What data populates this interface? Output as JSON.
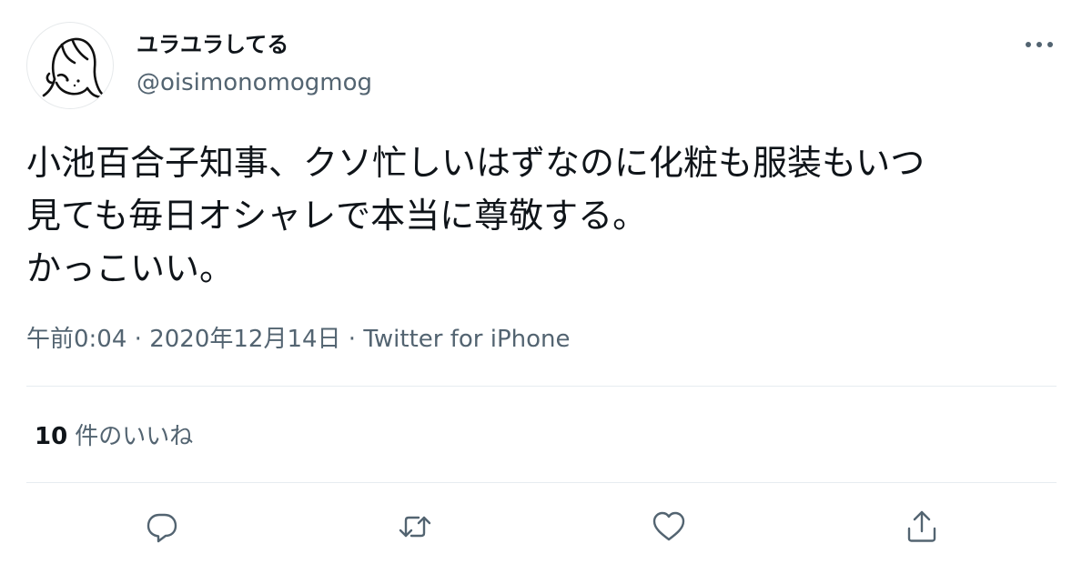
{
  "author": {
    "display_name": "ユラユラしてる",
    "handle": "@oisimonomogmog",
    "avatar_icon": "user-avatar-drawing"
  },
  "tweet": {
    "text": "小池百合子知事、クソ忙しいはずなのに化粧も服装もいつ\n見ても毎日オシャレで本当に尊敬する。\nかっこいい。",
    "time": "午前0:04",
    "separator": "·",
    "date": "2020年12月14日",
    "source": "Twitter for iPhone"
  },
  "stats": {
    "likes_count": "10",
    "likes_label": "件のいいね"
  },
  "actions": [
    {
      "name": "reply",
      "icon": "reply-icon"
    },
    {
      "name": "retweet",
      "icon": "retweet-icon"
    },
    {
      "name": "like",
      "icon": "heart-icon"
    },
    {
      "name": "share",
      "icon": "share-icon"
    }
  ],
  "colors": {
    "text_primary": "#0f1419",
    "text_secondary": "#536471",
    "divider": "#e6ecf0"
  }
}
